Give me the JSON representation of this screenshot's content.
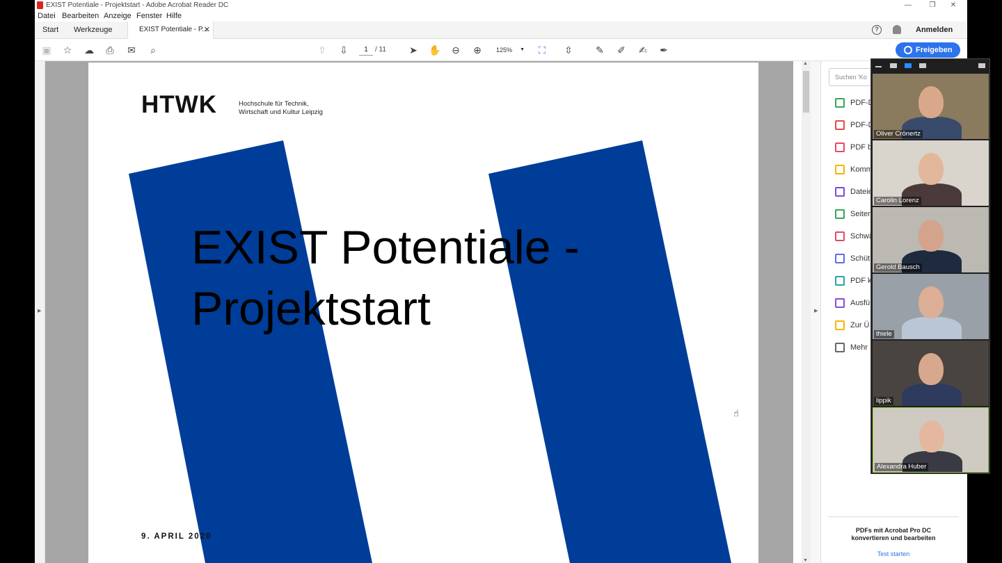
{
  "window": {
    "title": "EXIST Potentiale - Projektstart - Adobe Acrobat Reader DC",
    "minimize": "—",
    "maximize": "❐",
    "close": "✕"
  },
  "menu": [
    "Datei",
    "Bearbeiten",
    "Anzeige",
    "Fenster",
    "Hilfe"
  ],
  "tabs": {
    "home": "Start",
    "tools": "Werkzeuge",
    "document": "EXIST Potentiale - P...",
    "sign_in": "Anmelden"
  },
  "toolbar": {
    "current_page": "1",
    "page_total": "/ 11",
    "zoom": "125%",
    "share_label": "Freigeben"
  },
  "slide": {
    "logo": "HTWK",
    "logo_sub_line1": "Hochschule für Technik,",
    "logo_sub_line2": "Wirtschaft und Kultur Leipzig",
    "title_line1": "EXIST Potentiale -",
    "title_line2": "Projektstart",
    "date": "9. APRIL 2020",
    "stripe_color": "#003d99"
  },
  "tools_panel": {
    "search_placeholder": "Suchen 'Ko",
    "items": [
      {
        "label": "PDF-D",
        "color": "#3aa35a"
      },
      {
        "label": "PDF-D",
        "color": "#e24a4a"
      },
      {
        "label": "PDF b",
        "color": "#e24a6a"
      },
      {
        "label": "Komm",
        "color": "#f2b600"
      },
      {
        "label": "Dateie",
        "color": "#7a4ad8"
      },
      {
        "label": "Seiten",
        "color": "#3aa35a"
      },
      {
        "label": "Schwä",
        "color": "#e24a6a"
      },
      {
        "label": "Schüt",
        "color": "#5b6ee0"
      },
      {
        "label": "PDF k",
        "color": "#2aa3a0"
      },
      {
        "label": "Ausfü",
        "color": "#8a4ad8"
      },
      {
        "label": "Zur Ü",
        "color": "#f2b600"
      },
      {
        "label": "Mehr",
        "color": "#666666"
      }
    ],
    "promo_text": "PDFs mit Acrobat Pro DC konvertieren und bearbeiten",
    "promo_link": "Test starten"
  },
  "participants": [
    {
      "name": "Oliver Crönertz",
      "bg": "#8a7a5e",
      "skin": "#d9a88a",
      "shirt": "#3a4a6a"
    },
    {
      "name": "Carolin Lorenz",
      "bg": "#d9d4cc",
      "skin": "#e2b79c",
      "shirt": "#4a3a3a"
    },
    {
      "name": "Gerold Bausch",
      "bg": "#bcb8b2",
      "skin": "#d4a38c",
      "shirt": "#1e2a3e"
    },
    {
      "name": "thiele",
      "bg": "#9aa0a8",
      "skin": "#dcae96",
      "shirt": "#b9c6d6"
    },
    {
      "name": "lippik",
      "bg": "#4a4440",
      "skin": "#d8a88e",
      "shirt": "#2e3a5e"
    },
    {
      "name": "Alexandra Huber",
      "bg": "#cfcac2",
      "skin": "#e4b8a0",
      "shirt": "#3a3a44"
    }
  ]
}
